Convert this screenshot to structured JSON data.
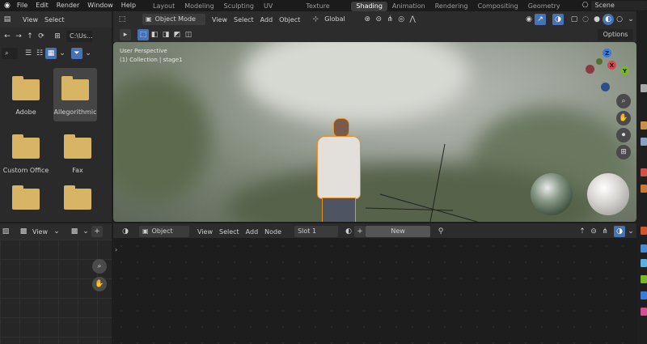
{
  "topbar": {
    "menus": [
      "File",
      "Edit",
      "Render",
      "Window",
      "Help"
    ],
    "workspaces": [
      "Layout",
      "Modeling",
      "Sculpting",
      "UV Editing",
      "Texture Paint",
      "Shading",
      "Animation",
      "Rendering",
      "Compositing",
      "Geometry Noc"
    ],
    "active_workspace": "Shading",
    "scene": "Scene"
  },
  "file_browser": {
    "menu": [
      "View",
      "Select"
    ],
    "path": "C:\\Us...",
    "folders": [
      {
        "name": "Adobe"
      },
      {
        "name": "Allegorithmic"
      },
      {
        "name": "Custom Office"
      },
      {
        "name": "Fax"
      },
      {
        "name": ""
      },
      {
        "name": ""
      }
    ]
  },
  "viewport": {
    "mode": "Object Mode",
    "menu": [
      "View",
      "Select",
      "Add",
      "Object"
    ],
    "orientation": "Global",
    "options_label": "Options",
    "overlay_line1": "User Perspective",
    "overlay_line2": "(1) Collection | stage1",
    "gizmo_axes": {
      "z": "Z",
      "x": "X",
      "y": "Y"
    }
  },
  "image_editor_header": {
    "view_label": "View"
  },
  "node_editor": {
    "object_label": "Object",
    "menu": [
      "View",
      "Select",
      "Add",
      "Node"
    ],
    "slot_label": "Slot 1",
    "new_label": "New"
  },
  "colors": {
    "accent": "#4772b3",
    "folder": "#d8b465",
    "selection_outline": "#e8902a",
    "axis_x": "#e0424f",
    "axis_y": "#7bb52b",
    "axis_z": "#3b7ad6"
  }
}
